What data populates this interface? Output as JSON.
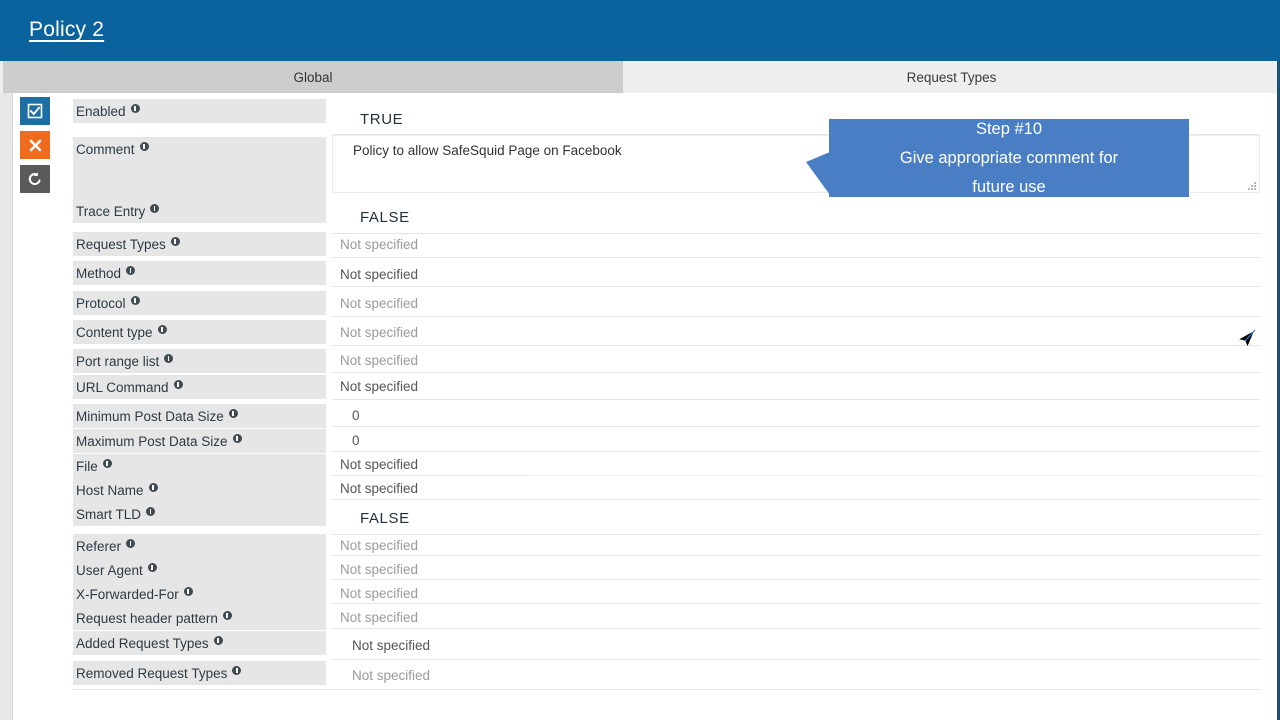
{
  "header": {
    "title": "Policy 2",
    "background": "#0a639c"
  },
  "tabs": [
    {
      "label": "Global",
      "active": true
    },
    {
      "label": "Request Types",
      "active": false
    }
  ],
  "side_actions": [
    {
      "name": "enable",
      "icon": "checkbox-icon",
      "color": "#1d6ea3"
    },
    {
      "name": "delete",
      "icon": "close-icon",
      "color": "#ef6c1f"
    },
    {
      "name": "reset",
      "icon": "undo-icon",
      "color": "#5a5a5a"
    }
  ],
  "fields": [
    {
      "label": "Enabled",
      "value": "TRUE",
      "style": "big"
    },
    {
      "label": "Comment",
      "value": "Policy to allow SafeSquid Page on Facebook",
      "style": "textarea"
    },
    {
      "label": "Trace Entry",
      "value": "FALSE",
      "style": "big"
    },
    {
      "label": "Request Types",
      "value": "Not specified",
      "style": "muted"
    },
    {
      "label": "Method",
      "value": "Not specified",
      "style": "dark"
    },
    {
      "label": "Protocol",
      "value": "Not specified",
      "style": "muted"
    },
    {
      "label": "Content type",
      "value": "Not specified",
      "style": "muted"
    },
    {
      "label": "Port range list",
      "value": "Not specified",
      "style": "muted"
    },
    {
      "label": "URL Command",
      "value": "Not specified",
      "style": "dark"
    },
    {
      "label": "Minimum Post Data Size",
      "value": "0",
      "style": "dark"
    },
    {
      "label": "Maximum Post Data Size",
      "value": "0",
      "style": "dark"
    },
    {
      "label": "File",
      "value": "Not specified",
      "style": "dark"
    },
    {
      "label": "Host Name",
      "value": "Not specified",
      "style": "dark"
    },
    {
      "label": "Smart TLD",
      "value": "FALSE",
      "style": "big"
    },
    {
      "label": "Referer",
      "value": "Not specified",
      "style": "muted"
    },
    {
      "label": "User Agent",
      "value": "Not specified",
      "style": "muted"
    },
    {
      "label": "X-Forwarded-For",
      "value": "Not specified",
      "style": "muted"
    },
    {
      "label": "Request header pattern",
      "value": "Not specified",
      "style": "muted"
    },
    {
      "label": "Added Request Types",
      "value": "Not specified",
      "style": "dark"
    },
    {
      "label": "Removed Request Types",
      "value": "Not specified",
      "style": "muted"
    }
  ],
  "callout": {
    "line1": "Step #10",
    "line2": "Give appropriate comment for",
    "line3": "future use",
    "color": "#4a7ec4"
  }
}
